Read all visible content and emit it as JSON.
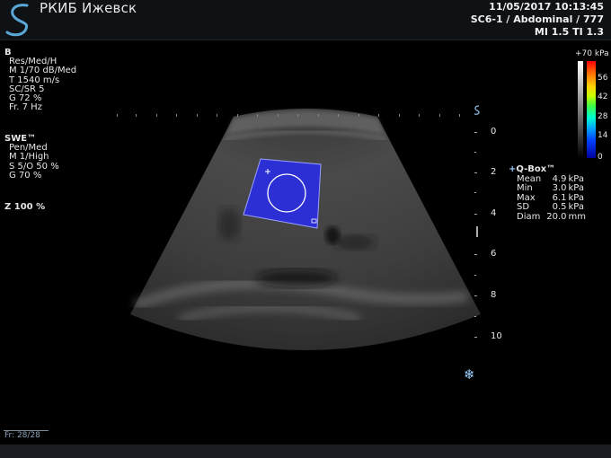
{
  "header": {
    "clinic_name": "РКИБ Ижевск",
    "datetime": "11/05/2017 10:13:45",
    "probe_preset": "SC6-1 / Abdominal / 777",
    "indices": "MI 1.5  TI 1.3"
  },
  "b_mode": {
    "label": "B",
    "params": [
      "Res/Med/H",
      "M 1/70 dB/Med",
      "T 1540 m/s",
      "SC/SR 5",
      "G 72 %",
      "Fr. 7 Hz"
    ]
  },
  "swe": {
    "label": "SWE™",
    "params": [
      "Pen/Med",
      "M 1/High",
      "S 5/O 50 %",
      "G 70 %"
    ]
  },
  "zoom": "Z  100  %",
  "depth_scale": {
    "labels": [
      "0",
      "2",
      "4",
      "6",
      "8",
      "10"
    ]
  },
  "color_scale": {
    "top_label": "+70 kPa",
    "ticks": [
      "56",
      "42",
      "28",
      "14",
      "0"
    ]
  },
  "qbox": {
    "title": "Q-Box™",
    "rows": [
      {
        "name": "Mean",
        "value": "4.9",
        "unit": "kPa"
      },
      {
        "name": "Min",
        "value": "3.0",
        "unit": "kPa"
      },
      {
        "name": "Max",
        "value": "6.1",
        "unit": "kPa"
      },
      {
        "name": "SD",
        "value": "0.5",
        "unit": "kPa"
      },
      {
        "name": "Diam",
        "value": "20.0",
        "unit": "mm"
      }
    ]
  },
  "frame_counter": "Fr: 28/28",
  "icons": {
    "logo": "supersonic-s-logo",
    "freeze": "snowflake-icon",
    "qbox_marker": "crosshair-icon"
  },
  "colors": {
    "background": "#000000",
    "swe_fill": "#2a2ee0",
    "text": "#e6e6e6",
    "logo": "#5aa8d8"
  }
}
